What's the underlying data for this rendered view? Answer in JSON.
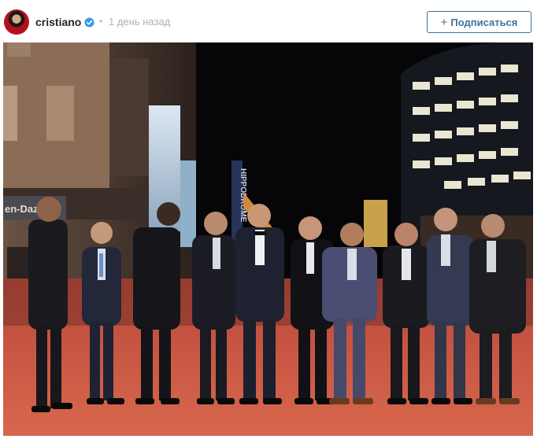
{
  "post": {
    "username": "cristiano",
    "separator": "•",
    "timestamp": "1 день назад",
    "follow_label": "Подписаться",
    "follow_icon": "+",
    "verified_icon": "verified-badge-icon"
  },
  "photo": {
    "description_icon": "post-photo",
    "signage": [
      "en-Dazs",
      "HIPPODROME"
    ]
  },
  "colors": {
    "accent": "#3f729b",
    "verified": "#3897f0",
    "carpet": "#c9553f"
  }
}
